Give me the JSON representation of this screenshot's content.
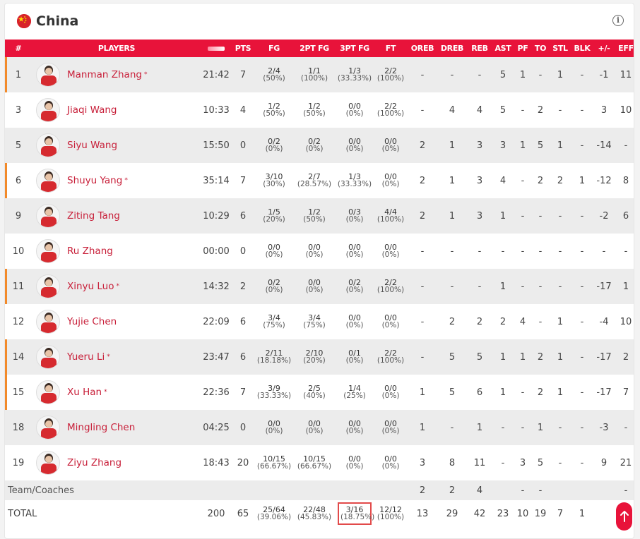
{
  "team": {
    "name": "China"
  },
  "headers": [
    "#",
    "PLAYERS",
    "",
    "PTS",
    "FG",
    "2PT FG",
    "3PT FG",
    "FT",
    "OREB",
    "DREB",
    "REB",
    "AST",
    "PF",
    "TO",
    "STL",
    "BLK",
    "+/-",
    "EFF"
  ],
  "players": [
    {
      "no": "1",
      "name": "Manman Zhang",
      "starter": true,
      "min": "21:42",
      "pts": "7",
      "fg": [
        "2/4",
        "(50%)"
      ],
      "fg2": [
        "1/1",
        "(100%)"
      ],
      "fg3": [
        "1/3",
        "(33.33%)"
      ],
      "ft": [
        "2/2",
        "(100%)"
      ],
      "oreb": "-",
      "dreb": "-",
      "reb": "-",
      "ast": "5",
      "pf": "1",
      "to": "-",
      "stl": "1",
      "blk": "-",
      "pm": "-1",
      "eff": "11"
    },
    {
      "no": "3",
      "name": "Jiaqi Wang",
      "starter": false,
      "min": "10:33",
      "pts": "4",
      "fg": [
        "1/2",
        "(50%)"
      ],
      "fg2": [
        "1/2",
        "(50%)"
      ],
      "fg3": [
        "0/0",
        "(0%)"
      ],
      "ft": [
        "2/2",
        "(100%)"
      ],
      "oreb": "-",
      "dreb": "4",
      "reb": "4",
      "ast": "5",
      "pf": "-",
      "to": "2",
      "stl": "-",
      "blk": "-",
      "pm": "3",
      "eff": "10"
    },
    {
      "no": "5",
      "name": "Siyu Wang",
      "starter": false,
      "min": "15:50",
      "pts": "0",
      "fg": [
        "0/2",
        "(0%)"
      ],
      "fg2": [
        "0/2",
        "(0%)"
      ],
      "fg3": [
        "0/0",
        "(0%)"
      ],
      "ft": [
        "0/0",
        "(0%)"
      ],
      "oreb": "2",
      "dreb": "1",
      "reb": "3",
      "ast": "3",
      "pf": "1",
      "to": "5",
      "stl": "1",
      "blk": "-",
      "pm": "-14",
      "eff": "-"
    },
    {
      "no": "6",
      "name": "Shuyu Yang",
      "starter": true,
      "min": "35:14",
      "pts": "7",
      "fg": [
        "3/10",
        "(30%)"
      ],
      "fg2": [
        "2/7",
        "(28.57%)"
      ],
      "fg3": [
        "1/3",
        "(33.33%)"
      ],
      "ft": [
        "0/0",
        "(0%)"
      ],
      "oreb": "2",
      "dreb": "1",
      "reb": "3",
      "ast": "4",
      "pf": "-",
      "to": "2",
      "stl": "2",
      "blk": "1",
      "pm": "-12",
      "eff": "8"
    },
    {
      "no": "9",
      "name": "Ziting Tang",
      "starter": false,
      "min": "10:29",
      "pts": "6",
      "fg": [
        "1/5",
        "(20%)"
      ],
      "fg2": [
        "1/2",
        "(50%)"
      ],
      "fg3": [
        "0/3",
        "(0%)"
      ],
      "ft": [
        "4/4",
        "(100%)"
      ],
      "oreb": "2",
      "dreb": "1",
      "reb": "3",
      "ast": "1",
      "pf": "-",
      "to": "-",
      "stl": "-",
      "blk": "-",
      "pm": "-2",
      "eff": "6"
    },
    {
      "no": "10",
      "name": "Ru Zhang",
      "starter": false,
      "min": "00:00",
      "pts": "0",
      "fg": [
        "0/0",
        "(0%)"
      ],
      "fg2": [
        "0/0",
        "(0%)"
      ],
      "fg3": [
        "0/0",
        "(0%)"
      ],
      "ft": [
        "0/0",
        "(0%)"
      ],
      "oreb": "-",
      "dreb": "-",
      "reb": "-",
      "ast": "-",
      "pf": "-",
      "to": "-",
      "stl": "-",
      "blk": "-",
      "pm": "-",
      "eff": "-"
    },
    {
      "no": "11",
      "name": "Xinyu Luo",
      "starter": true,
      "min": "14:32",
      "pts": "2",
      "fg": [
        "0/2",
        "(0%)"
      ],
      "fg2": [
        "0/0",
        "(0%)"
      ],
      "fg3": [
        "0/2",
        "(0%)"
      ],
      "ft": [
        "2/2",
        "(100%)"
      ],
      "oreb": "-",
      "dreb": "-",
      "reb": "-",
      "ast": "1",
      "pf": "-",
      "to": "-",
      "stl": "-",
      "blk": "-",
      "pm": "-17",
      "eff": "1"
    },
    {
      "no": "12",
      "name": "Yujie Chen",
      "starter": false,
      "min": "22:09",
      "pts": "6",
      "fg": [
        "3/4",
        "(75%)"
      ],
      "fg2": [
        "3/4",
        "(75%)"
      ],
      "fg3": [
        "0/0",
        "(0%)"
      ],
      "ft": [
        "0/0",
        "(0%)"
      ],
      "oreb": "-",
      "dreb": "2",
      "reb": "2",
      "ast": "2",
      "pf": "4",
      "to": "-",
      "stl": "1",
      "blk": "-",
      "pm": "-4",
      "eff": "10"
    },
    {
      "no": "14",
      "name": "Yueru Li",
      "starter": true,
      "min": "23:47",
      "pts": "6",
      "fg": [
        "2/11",
        "(18.18%)"
      ],
      "fg2": [
        "2/10",
        "(20%)"
      ],
      "fg3": [
        "0/1",
        "(0%)"
      ],
      "ft": [
        "2/2",
        "(100%)"
      ],
      "oreb": "-",
      "dreb": "5",
      "reb": "5",
      "ast": "1",
      "pf": "1",
      "to": "2",
      "stl": "1",
      "blk": "-",
      "pm": "-17",
      "eff": "2"
    },
    {
      "no": "15",
      "name": "Xu Han",
      "starter": true,
      "min": "22:36",
      "pts": "7",
      "fg": [
        "3/9",
        "(33.33%)"
      ],
      "fg2": [
        "2/5",
        "(40%)"
      ],
      "fg3": [
        "1/4",
        "(25%)"
      ],
      "ft": [
        "0/0",
        "(0%)"
      ],
      "oreb": "1",
      "dreb": "5",
      "reb": "6",
      "ast": "1",
      "pf": "-",
      "to": "2",
      "stl": "1",
      "blk": "-",
      "pm": "-17",
      "eff": "7"
    },
    {
      "no": "18",
      "name": "Mingling Chen",
      "starter": false,
      "min": "04:25",
      "pts": "0",
      "fg": [
        "0/0",
        "(0%)"
      ],
      "fg2": [
        "0/0",
        "(0%)"
      ],
      "fg3": [
        "0/0",
        "(0%)"
      ],
      "ft": [
        "0/0",
        "(0%)"
      ],
      "oreb": "1",
      "dreb": "-",
      "reb": "1",
      "ast": "-",
      "pf": "-",
      "to": "1",
      "stl": "-",
      "blk": "-",
      "pm": "-3",
      "eff": "-"
    },
    {
      "no": "19",
      "name": "Ziyu Zhang",
      "starter": false,
      "min": "18:43",
      "pts": "20",
      "fg": [
        "10/15",
        "(66.67%)"
      ],
      "fg2": [
        "10/15",
        "(66.67%)"
      ],
      "fg3": [
        "0/0",
        "(0%)"
      ],
      "ft": [
        "0/0",
        "(0%)"
      ],
      "oreb": "3",
      "dreb": "8",
      "reb": "11",
      "ast": "-",
      "pf": "3",
      "to": "5",
      "stl": "-",
      "blk": "-",
      "pm": "9",
      "eff": "21"
    }
  ],
  "coaches": {
    "label": "Team/Coaches",
    "oreb": "2",
    "dreb": "2",
    "reb": "4",
    "pf": "-",
    "to": "-",
    "eff": "-"
  },
  "total": {
    "label": "TOTAL",
    "min": "200",
    "pts": "65",
    "fg": [
      "25/64",
      "(39.06%)"
    ],
    "fg2": [
      "22/48",
      "(45.83%)"
    ],
    "fg3": [
      "3/16",
      "(18.75%)"
    ],
    "ft": [
      "12/12",
      "(100%)"
    ],
    "oreb": "13",
    "dreb": "29",
    "reb": "42",
    "ast": "23",
    "pf": "10",
    "to": "19",
    "stl": "7",
    "blk": "1"
  },
  "colors": {
    "accent": "#e8133a",
    "starter_bar": "#f28a2a",
    "name": "#c8203a",
    "highlight": "#e24a4a"
  },
  "icons": {
    "flag": "china-flag-icon",
    "info": "info-icon",
    "minutes": "minutes-bar-icon",
    "scroll_top": "arrow-up-icon"
  },
  "info_glyph": "i"
}
